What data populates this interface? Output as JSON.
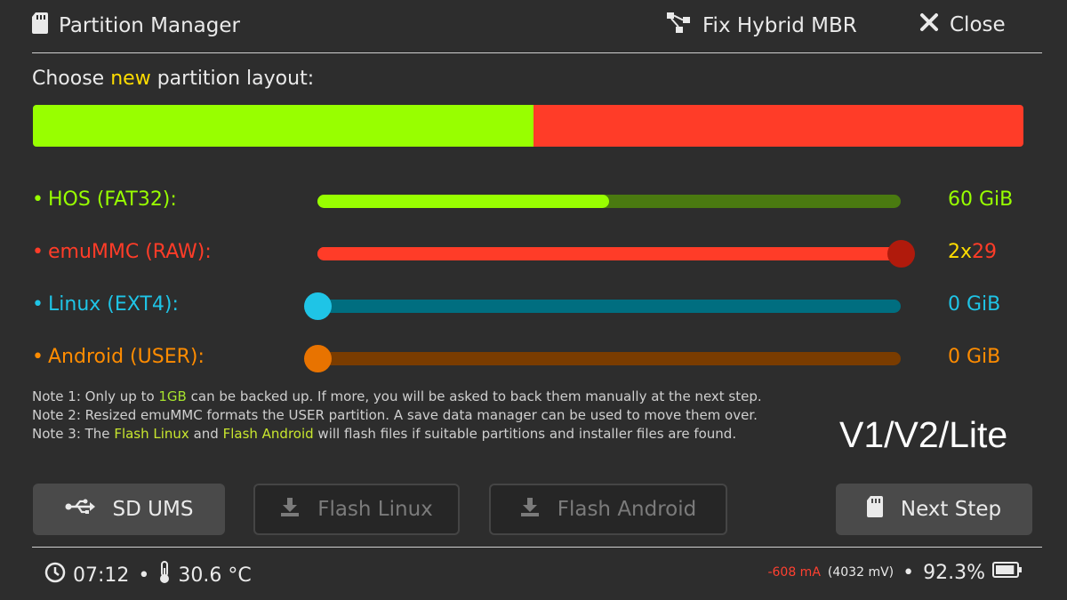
{
  "header": {
    "title": "Partition Manager",
    "fix_hybrid_label": "Fix Hybrid MBR",
    "close_label": "Close"
  },
  "layout": {
    "choose_prefix": "Choose ",
    "choose_new": "new",
    "choose_suffix": " partition layout:",
    "segments": [
      {
        "name": "HOS",
        "fraction": 0.505,
        "color": "#98ff00"
      },
      {
        "name": "emuMMC",
        "fraction": 0.495,
        "color": "#ff3c28"
      }
    ]
  },
  "partitions": [
    {
      "label": "HOS (FAT32):",
      "value": "60 GiB",
      "color": "#98ff00",
      "track_color": "#4a7a10",
      "level": 0.5,
      "knob": false
    },
    {
      "label": "emuMMC (RAW):",
      "value_prefix": "2x",
      "value": "29",
      "color": "#ff3c28",
      "track_color": "#ff3c28",
      "level": 1.0,
      "knob": true,
      "knob_color": "#b01a0c"
    },
    {
      "label": "Linux (EXT4):",
      "value": "0 GiB",
      "color": "#1fc4e6",
      "track_color": "#006e80",
      "level": 0.0,
      "knob": true,
      "knob_color": "#1fc4e6"
    },
    {
      "label": "Android (USER):",
      "value": "0 GiB",
      "color": "#ff8c00",
      "track_color": "#7a3c00",
      "level": 0.0,
      "knob": true,
      "knob_color": "#e87300"
    }
  ],
  "notes": {
    "note1_a": "Note 1: Only up to ",
    "note1_hl": "1GB",
    "note1_b": " can be backed up. If more, you will be asked to back them manually at the next step.",
    "note2": "Note 2: Resized emuMMC formats the USER partition. A save data manager can be used to move them over.",
    "note3_a": "Note 3: The ",
    "note3_hl1": "Flash Linux",
    "note3_b": " and ",
    "note3_hl2": "Flash Android",
    "note3_c": " will flash files if suitable partitions and installer files are found."
  },
  "model": "V1/V2/Lite",
  "buttons": {
    "sd_ums": "SD UMS",
    "flash_linux": "Flash Linux",
    "flash_android": "Flash Android",
    "next_step": "Next Step"
  },
  "footer": {
    "time": "07:12",
    "temperature": "30.6 °C",
    "current": "-608 mA",
    "voltage": "(4032 mV)",
    "battery": "92.3%",
    "battery_level": 0.923
  },
  "icons": {
    "sd": "sd-card-icon",
    "fix": "hierarchy-icon",
    "close": "close-icon",
    "usb": "usb-icon",
    "download": "download-icon",
    "clock": "clock-icon",
    "thermometer": "thermometer-icon",
    "battery": "battery-icon"
  }
}
